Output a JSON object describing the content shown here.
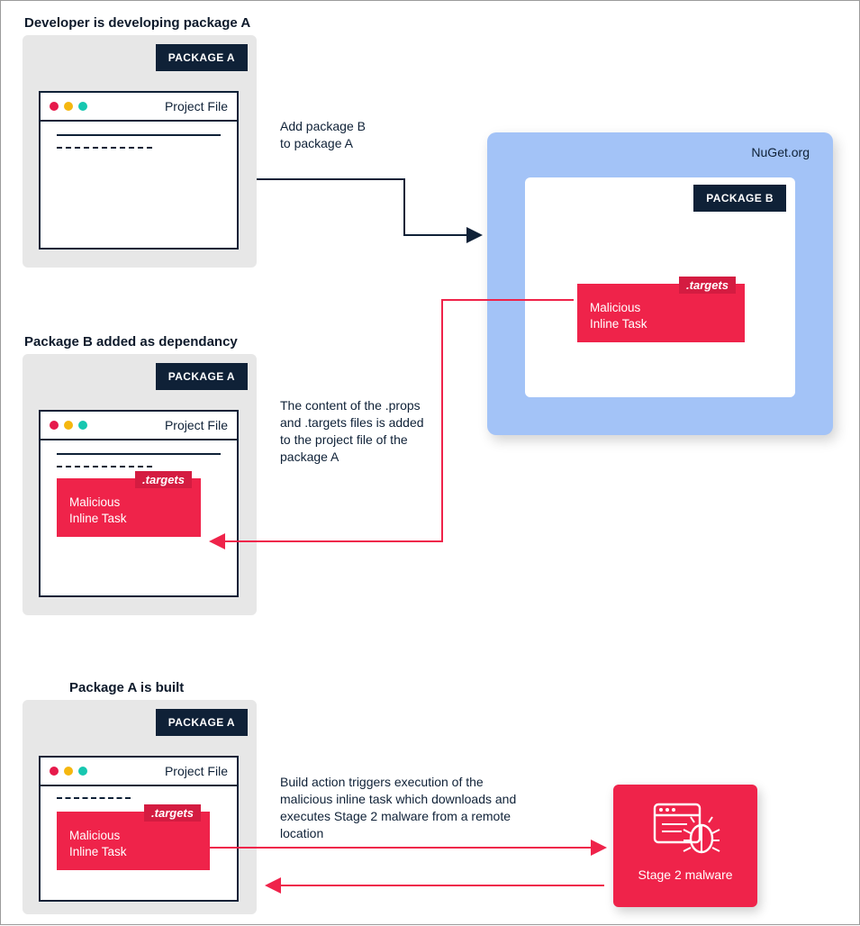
{
  "stage1": {
    "title": "Developer is developing package A",
    "package_label": "PACKAGE A",
    "window_title": "Project File"
  },
  "stage2": {
    "title": "Package B added as dependancy",
    "package_label": "PACKAGE A",
    "window_title": "Project File"
  },
  "stage3": {
    "title": "Package A is built",
    "package_label": "PACKAGE A",
    "window_title": "Project File"
  },
  "nuget": {
    "title": "NuGet.org",
    "package_label": "PACKAGE B"
  },
  "malicious": {
    "tag": ".targets",
    "text": "Malicious\nInline Task"
  },
  "annotations": {
    "arrow1": "Add package B\nto package A",
    "arrow2": "The content of the .props and .targets files is added to the project file of the package A",
    "arrow3": "Build action triggers execution of the malicious inline task which downloads and executes Stage 2 malware from a remote location"
  },
  "malware": {
    "label": "Stage 2 malware"
  }
}
